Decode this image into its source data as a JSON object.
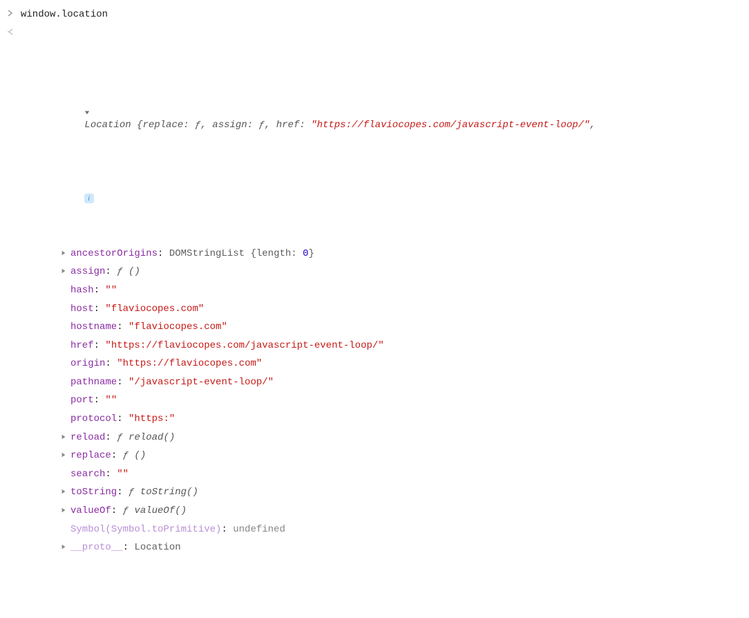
{
  "input": {
    "command": "window.location"
  },
  "summary": {
    "constructorName": "Location",
    "preview": {
      "replace": "ƒ",
      "assign": "ƒ",
      "href": "\"https://flaviocopes.com/javascript-event-loop/\""
    },
    "trailingComma": ","
  },
  "props": [
    {
      "expandable": true,
      "key": "ancestorOrigins",
      "value_plain": "DOMStringList {length: ",
      "value_num": "0",
      "value_suffix": "}"
    },
    {
      "expandable": true,
      "key": "assign",
      "value_func": "ƒ ()"
    },
    {
      "expandable": false,
      "key": "hash",
      "value_str": "\"\""
    },
    {
      "expandable": false,
      "key": "host",
      "value_str": "\"flaviocopes.com\""
    },
    {
      "expandable": false,
      "key": "hostname",
      "value_str": "\"flaviocopes.com\""
    },
    {
      "expandable": false,
      "key": "href",
      "value_str": "\"https://flaviocopes.com/javascript-event-loop/\""
    },
    {
      "expandable": false,
      "key": "origin",
      "value_str": "\"https://flaviocopes.com\""
    },
    {
      "expandable": false,
      "key": "pathname",
      "value_str": "\"/javascript-event-loop/\""
    },
    {
      "expandable": false,
      "key": "port",
      "value_str": "\"\""
    },
    {
      "expandable": false,
      "key": "protocol",
      "value_str": "\"https:\""
    },
    {
      "expandable": true,
      "key": "reload",
      "value_func": "ƒ reload()"
    },
    {
      "expandable": true,
      "key": "replace",
      "value_func": "ƒ ()"
    },
    {
      "expandable": false,
      "key": "search",
      "value_str": "\"\""
    },
    {
      "expandable": true,
      "key": "toString",
      "value_func": "ƒ toString()"
    },
    {
      "expandable": true,
      "key": "valueOf",
      "value_func": "ƒ valueOf()"
    },
    {
      "expandable": false,
      "dimKey": true,
      "key": "Symbol(Symbol.toPrimitive)",
      "value_undef": "undefined"
    },
    {
      "expandable": true,
      "dimKey": true,
      "key": "__proto__",
      "value_plain": "Location"
    }
  ]
}
